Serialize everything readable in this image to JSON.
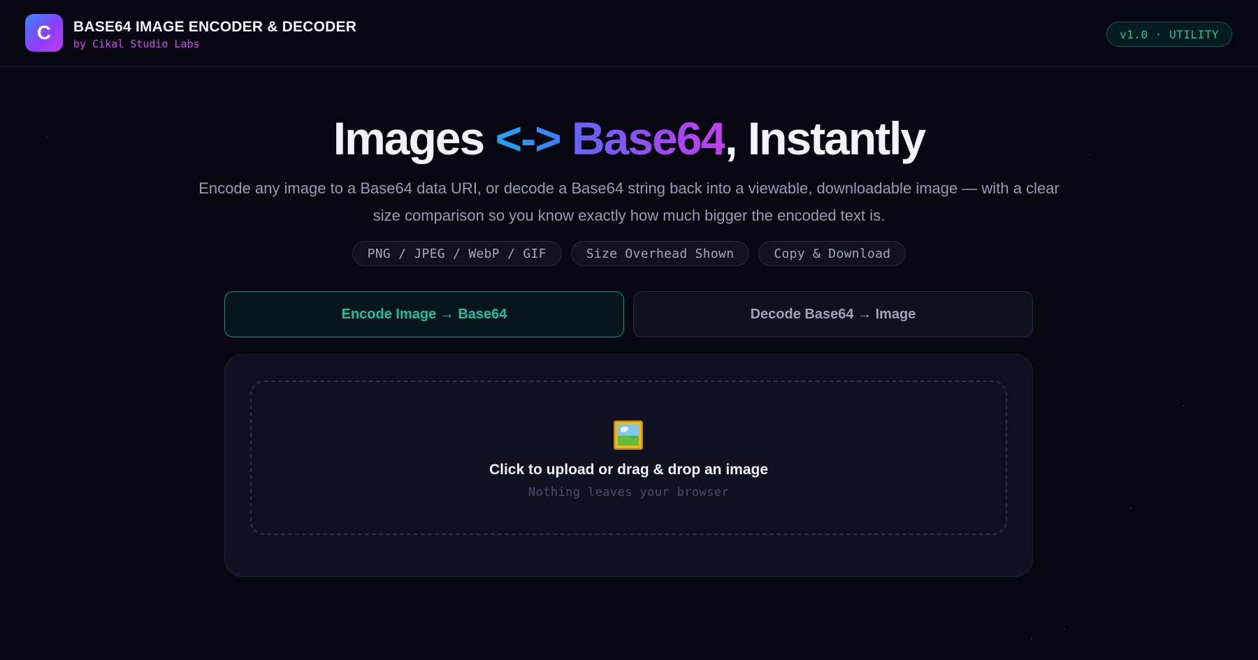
{
  "header": {
    "logo_letter": "C",
    "title": "BASE64 IMAGE ENCODER & DECODER",
    "subtitle": "by Cikal Studio Labs",
    "version_badge": "v1.0 · UTILITY"
  },
  "hero": {
    "title_part1": "Images ",
    "title_arrow": "<->",
    "title_base": " Base64",
    "title_part2": ", Instantly",
    "description": "Encode any image to a Base64 data URI, or decode a Base64 string back into a viewable, downloadable image — with a clear size comparison so you know exactly how much bigger the encoded text is."
  },
  "pills": [
    "PNG / JPEG / WebP / GIF",
    "Size Overhead Shown",
    "Copy & Download"
  ],
  "tabs": {
    "encode_label": "Encode Image → Base64",
    "decode_label": "Decode Base64 → Image",
    "active": "encode"
  },
  "dropzone": {
    "icon": "framed-picture-icon",
    "title": "Click to upload or drag & drop an image",
    "subtitle": "Nothing leaves your browser"
  },
  "colors": {
    "background": "#07070f",
    "accent_teal": "#1cc1a4",
    "accent_purple": "#9a4cf2",
    "accent_magenta": "#d04ef0"
  }
}
